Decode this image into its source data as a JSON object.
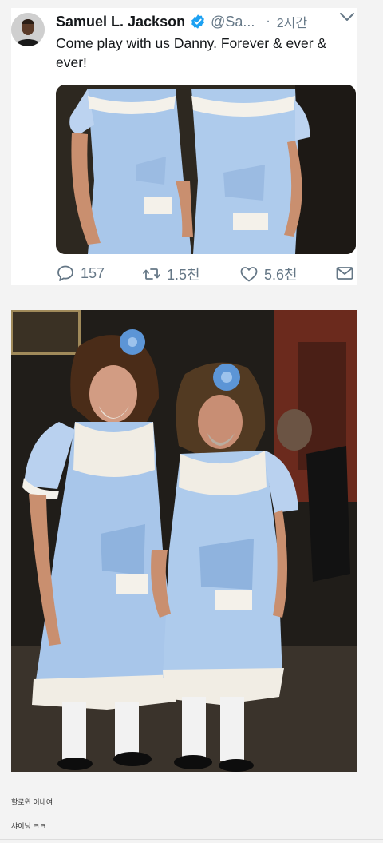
{
  "tweet": {
    "author_name": "Samuel L. Jackson",
    "handle": "@Sa...",
    "separator": "·",
    "time": "2시간",
    "text": "Come play with us Danny. Forever & ever & ever!",
    "icons": {
      "avatar": "profile-photo",
      "verified": "verified-badge-icon",
      "menu": "chevron-down-icon"
    },
    "actions": {
      "reply_count": "157",
      "retweet_count": "1.5천",
      "like_count": "5.6천"
    },
    "colors": {
      "text": "#14171a",
      "muted": "#657786",
      "verified": "#1da1f2"
    }
  },
  "comments": [
    {
      "text": "할로윈 이네여"
    },
    {
      "text": "샤이닝 ㅋㅋ"
    }
  ]
}
